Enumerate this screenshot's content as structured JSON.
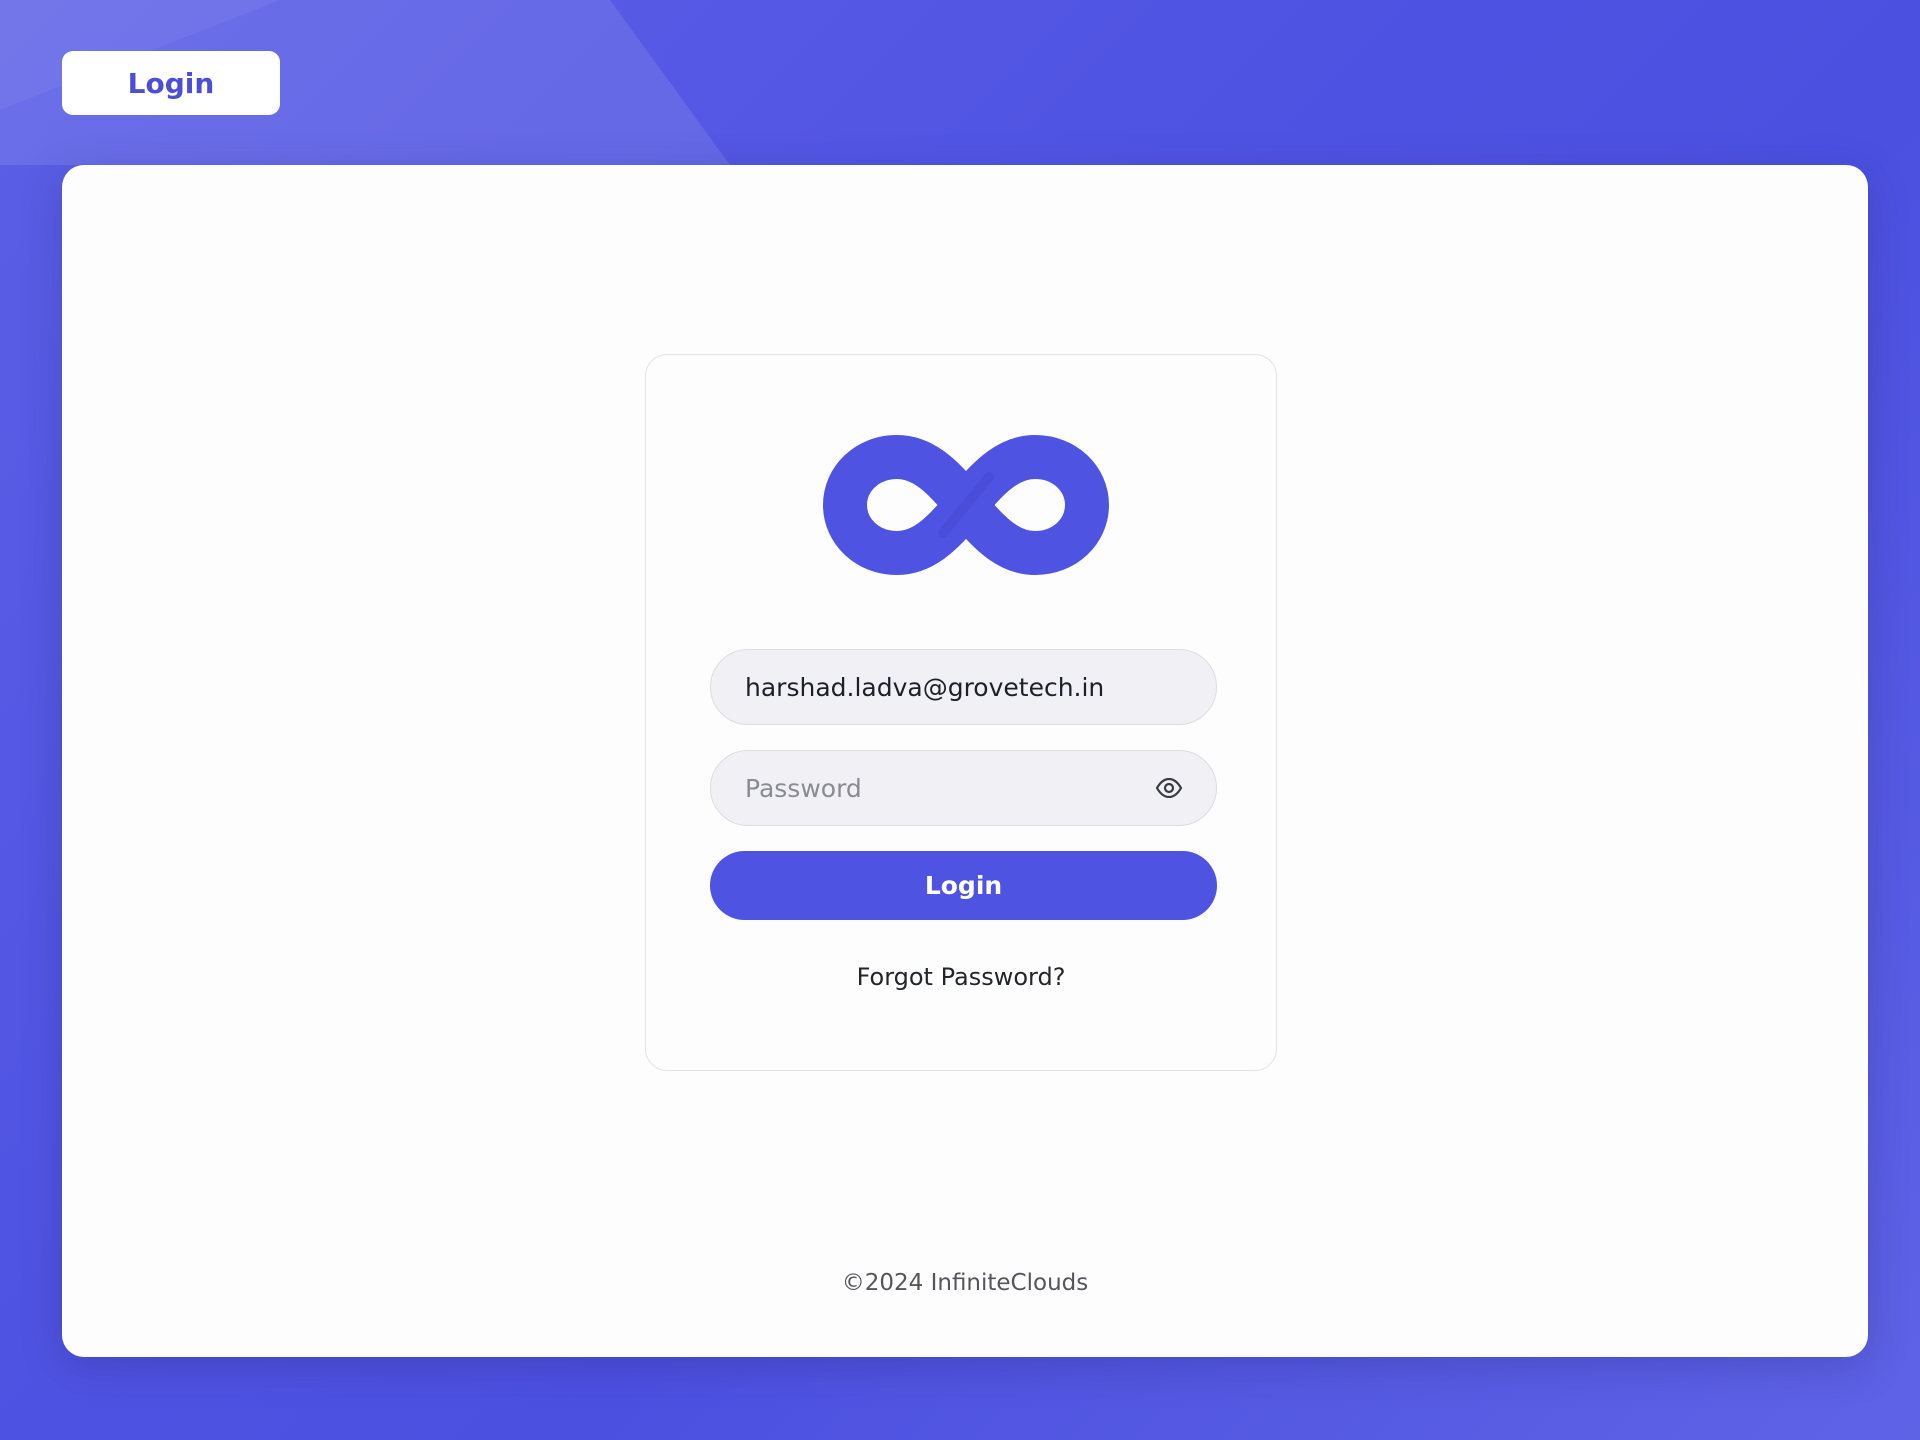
{
  "header": {
    "tab_label": "Login"
  },
  "logo": {
    "icon": "infinity-logo-icon",
    "color": "#4f53e2"
  },
  "form": {
    "email_value": "harshad.ladva@grovetech.in",
    "password_placeholder": "Password",
    "password_toggle_icon": "eye-icon",
    "login_button_label": "Login",
    "forgot_password_label": "Forgot Password?"
  },
  "footer": {
    "copyright": "©2024 InfiniteClouds"
  },
  "colors": {
    "accent": "#4f53e2",
    "background": "#5b5fe6"
  }
}
